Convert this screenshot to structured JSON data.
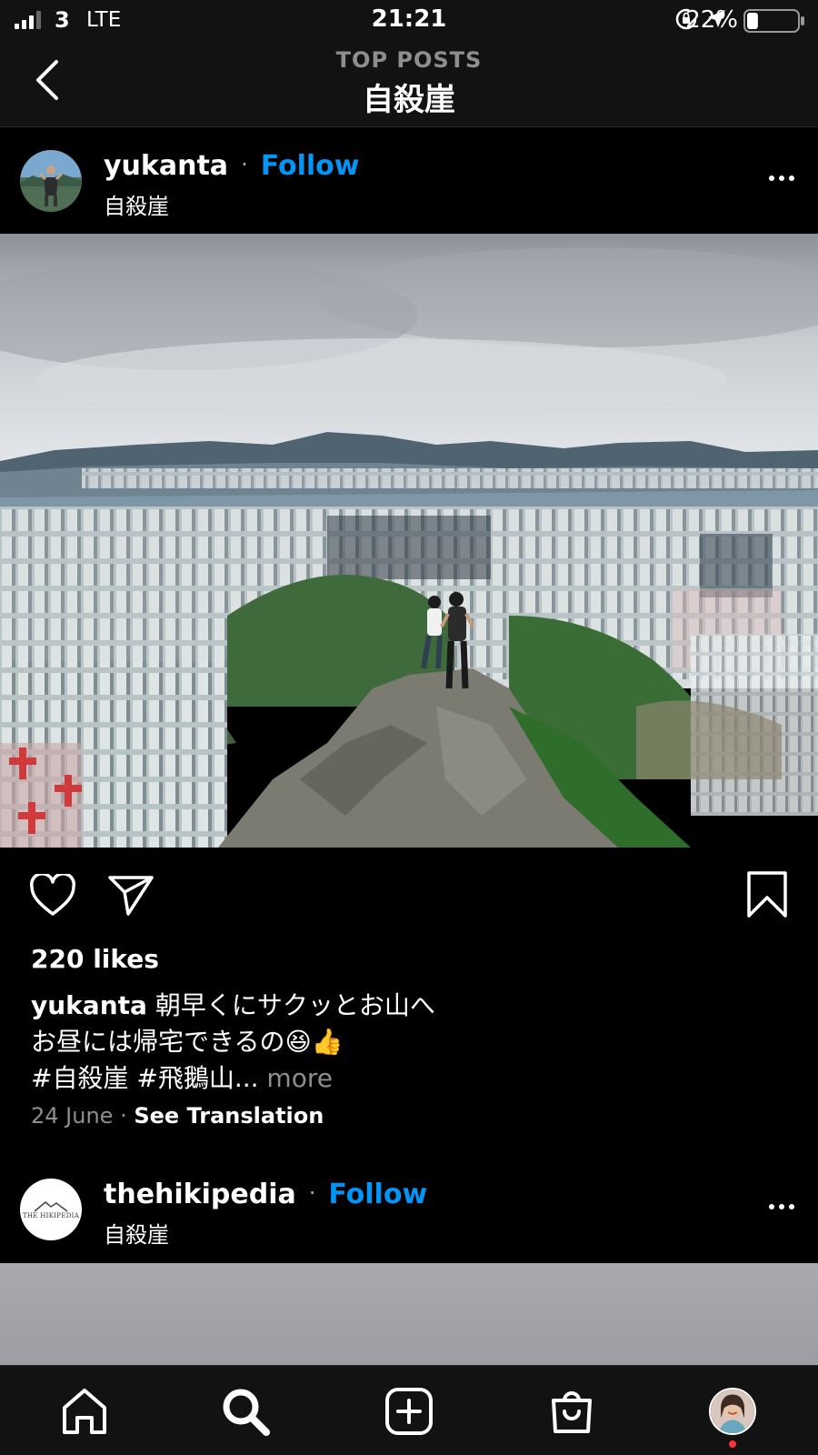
{
  "status_bar": {
    "carrier": "3",
    "network": "LTE",
    "time": "21:21",
    "battery": "22%",
    "battery_level": 0.22
  },
  "header": {
    "subtitle": "TOP POSTS",
    "title": "自殺崖"
  },
  "posts": [
    {
      "username": "yukanta",
      "separator": "·",
      "follow_label": "Follow",
      "location": "自殺崖",
      "likes": "220 likes",
      "caption_user": "yukanta",
      "caption_line1": " 朝早くにサクッとお山へ",
      "caption_line2": "お昼には帰宅できるの😆👍",
      "caption_line3": "#自殺崖 #飛鵝山...",
      "caption_more": " more",
      "date": "24 June",
      "meta_separator": " · ",
      "translation_label": "See Translation"
    },
    {
      "username": "thehikipedia",
      "separator": "·",
      "follow_label": "Follow",
      "location": "自殺崖",
      "avatar_text": "THE HIKIPEDIA"
    }
  ],
  "colors": {
    "background": "#000000",
    "bar_background": "#121212",
    "accent": "#0095f6",
    "muted": "#8e8e8e",
    "notification": "#ff3040"
  },
  "icons": {
    "back": "chevron-left-icon",
    "like": "heart-icon",
    "share": "paper-plane-icon",
    "save": "bookmark-icon",
    "more": "ellipsis-icon",
    "tabs": [
      "home-icon",
      "search-icon",
      "add-post-icon",
      "shop-icon",
      "profile-avatar"
    ]
  }
}
